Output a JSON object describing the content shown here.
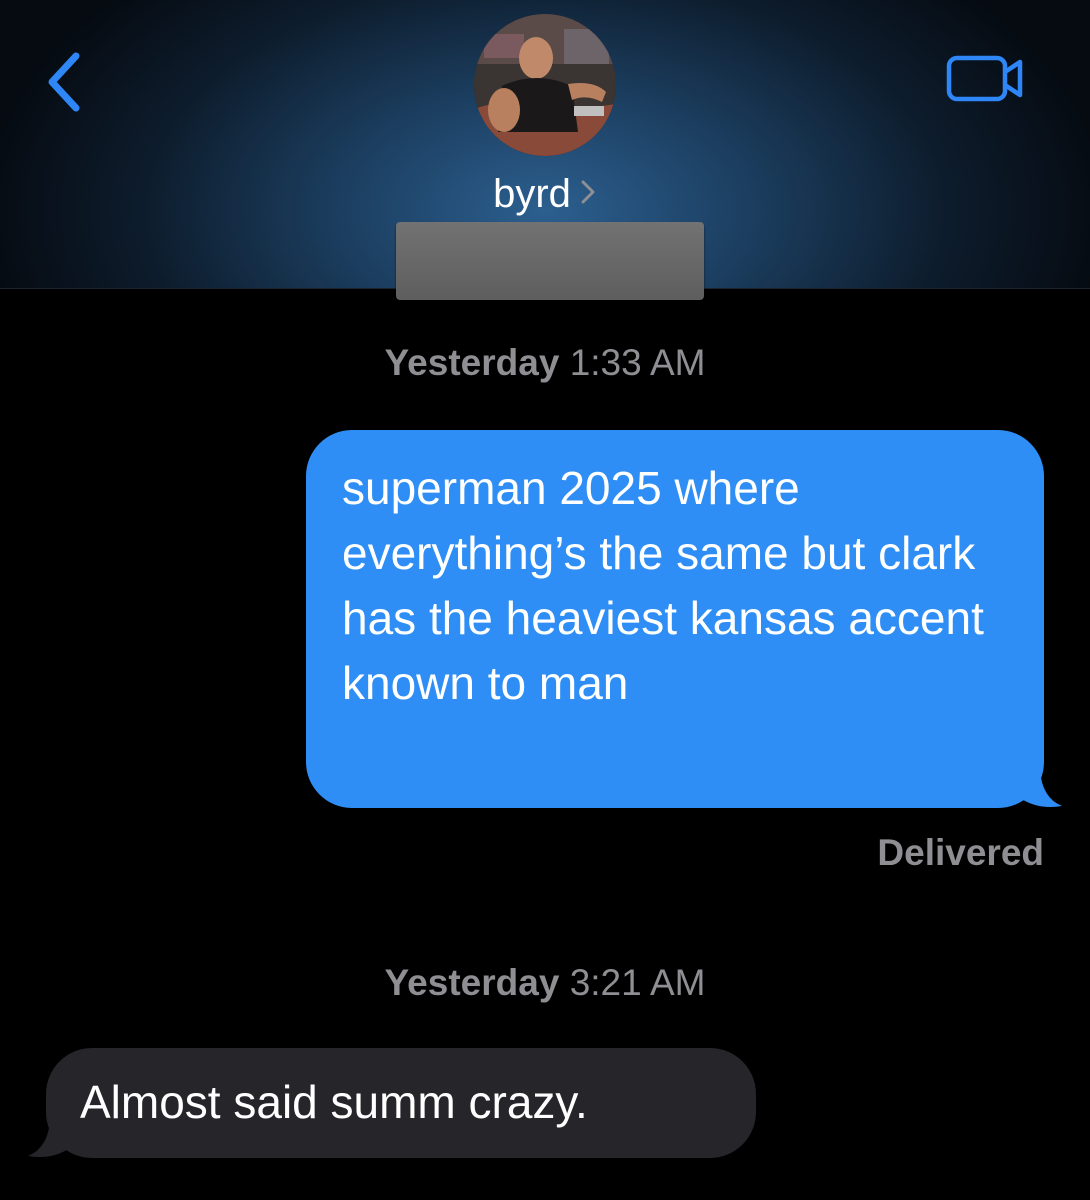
{
  "header": {
    "back_icon": "chevron-left-icon",
    "video_icon": "video-camera-icon",
    "contact_name": "byrd",
    "accent_color": "#2f86f6"
  },
  "messages": [
    {
      "timestamp_day": "Yesterday",
      "timestamp_time": "1:33 AM"
    },
    {
      "direction": "outgoing",
      "text": "superman 2025 where everything’s the same but clark has the heaviest kansas accent known to man",
      "color": "#2e8ef5"
    },
    {
      "status": "Delivered"
    },
    {
      "timestamp_day": "Yesterday",
      "timestamp_time": "3:21 AM"
    },
    {
      "direction": "incoming",
      "text": "Almost said summ crazy.",
      "color": "#26252a"
    }
  ]
}
